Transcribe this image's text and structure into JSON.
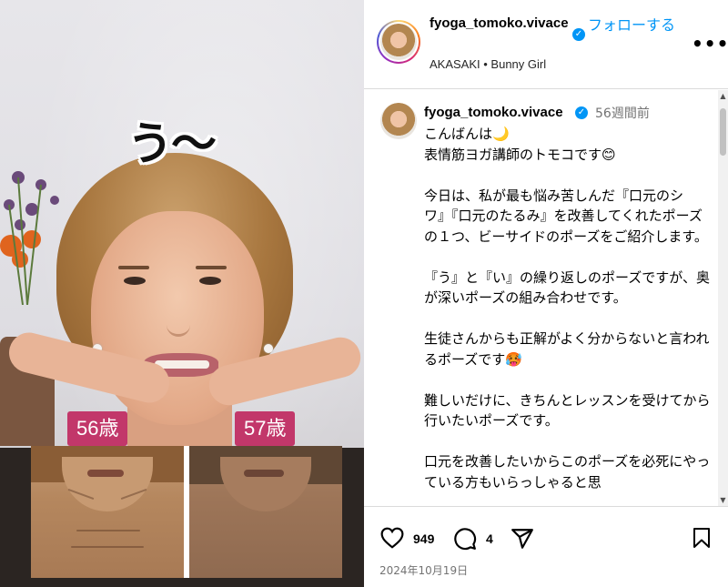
{
  "media": {
    "caption": "う〜",
    "badge_left": "56歳",
    "badge_right": "57歳"
  },
  "header": {
    "username": "fyoga_tomoko.vivace",
    "follow_label": "フォローする",
    "location": "AKASAKI • Bunny Girl",
    "more_label": "•••"
  },
  "comment": {
    "username": "fyoga_tomoko.vivace",
    "time": "56週間前",
    "body": "こんばんは🌙\n表情筋ヨガ講師のトモコです😊\n\n今日は、私が最も悩み苦しんだ『口元のシワ』『口元のたるみ』を改善してくれたポーズの１つ、ビーサイドのポーズをご紹介します。\n\n『う』と『い』の繰り返しのポーズですが、奥が深いポーズの組み合わせです。\n\n生徒さんからも正解がよく分からないと言われるポーズです🥵\n\n難しいだけに、きちんとレッスンを受けてから行いたいポーズです。\n\n口元を改善したいからこのポーズを必死にやっている方もいらっしゃると思"
  },
  "actions": {
    "likes": "949",
    "comments": "4",
    "date": "2024年10月19日"
  },
  "colors": {
    "accent": "#0095f6",
    "badge": "#c2376a"
  },
  "icons": [
    "heart-icon",
    "comment-icon",
    "share-icon",
    "bookmark-icon",
    "verified-icon",
    "more-icon"
  ]
}
